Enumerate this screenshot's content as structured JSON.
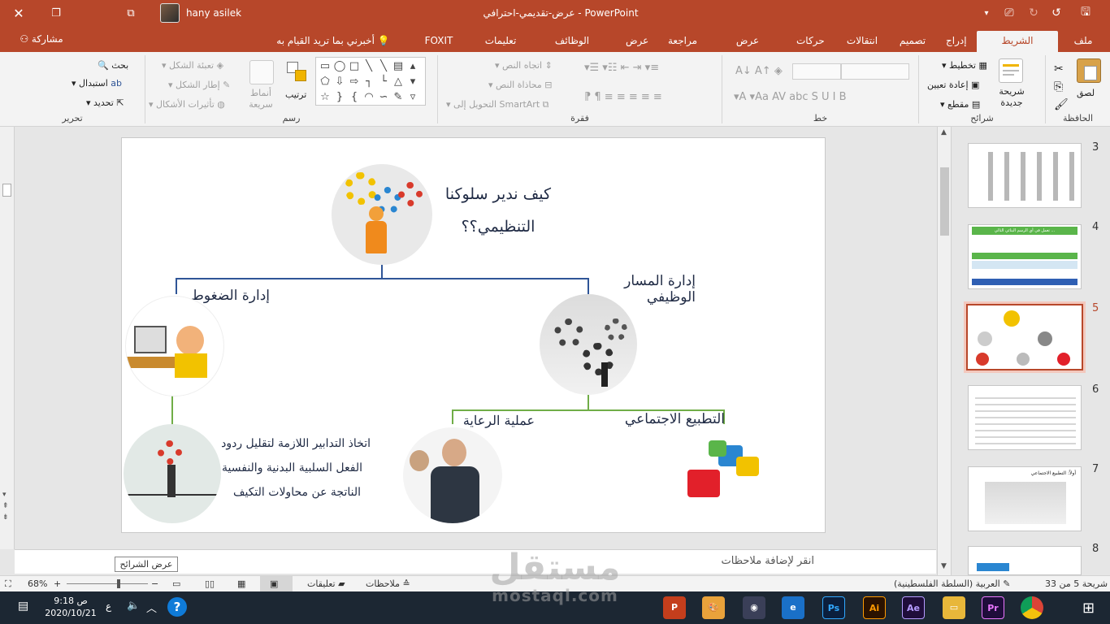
{
  "titlebar": {
    "title": "عرض-تقديمي-احترافي  -  PowerPoint",
    "user": "hany asilek"
  },
  "tabs": [
    "ملف",
    "الشريط الرئيسي",
    "إدراج",
    "تصميم",
    "انتقالات",
    "حركات",
    "عرض الشرائح",
    "مراجعة",
    "عرض",
    "الوظائف الإضافية",
    "تعليمات",
    "FOXIT PDF"
  ],
  "tell_me": "أخبرني بما تريد القيام به",
  "share": "مشاركة",
  "ribbon": {
    "clipboard": {
      "label": "الحافظة",
      "paste": "لصق"
    },
    "slides": {
      "label": "شرائح",
      "new_slide": "شريحة جديدة",
      "layout": "تخطيط",
      "reset": "إعادة تعيين",
      "section": "مقطع"
    },
    "font": {
      "label": "خط"
    },
    "paragraph": {
      "label": "فقرة",
      "text_direction": "اتجاه النص",
      "align_text": "محاذاة النص",
      "smartart": "التحويل إلى SmartArt"
    },
    "drawing": {
      "label": "رسم",
      "arrange": "ترتيب",
      "quick_styles": "أنماط سريعة",
      "fill": "تعبئة الشكل",
      "outline": "إطار الشكل",
      "effects": "تأثيرات الأشكال"
    },
    "editing": {
      "label": "تحرير",
      "find": "بحث",
      "replace": "استبدال",
      "select": "تحديد"
    }
  },
  "slide": {
    "title_line1": "كيف ندير سلوكنا",
    "title_line2": "التنظيمي؟؟",
    "career": "إدارة المسار الوظيفي",
    "stress": "إدارة الضغوط",
    "socialization": "التطبيع الاجتماعي",
    "mentoring": "عملية الرعاية",
    "measures_line1": "اتخاذ التدابير اللازمة لتقليل ردود",
    "measures_line2": "الفعل السلبية البدنية والنفسية",
    "measures_line3": "الناتجة عن محاولات التكيف"
  },
  "thumbnails": [
    "3",
    "4",
    "5",
    "6",
    "7",
    "8"
  ],
  "thumb_texts": {
    "t4_top": "تعمل في أي الرسم البنائي التالي ...",
    "t7_title": "أولاً: التطبيع الاجتماعي"
  },
  "notes_placeholder": "انقر لإضافة ملاحظات",
  "status": {
    "slide_count": "شريحة 5 من 33",
    "language": "العربية (السلطة الفلسطينية)",
    "notes": "ملاحظات",
    "comments": "تعليقات",
    "zoom": "68%",
    "tooltip": "عرض الشرائح"
  },
  "taskbar": {
    "time": "9:18 ص",
    "date": "2020/10/21",
    "lang": "ع"
  },
  "watermark": {
    "arabic": "مستقل",
    "latin": "mostaql.com"
  },
  "colors": {
    "accent": "#b7472a",
    "connector_blue": "#2f5597",
    "connector_green": "#70ad47"
  }
}
